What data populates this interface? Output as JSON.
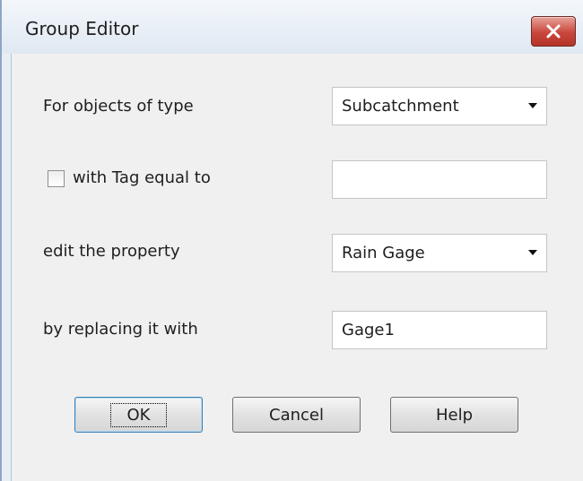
{
  "window": {
    "title": "Group Editor"
  },
  "form": {
    "object_type_label": "For objects of type",
    "object_type_value": "Subcatchment",
    "tag_label": "with Tag equal to",
    "tag_checked": false,
    "tag_value": "",
    "property_label": "edit the property",
    "property_value": "Rain Gage",
    "replace_label": "by replacing it with",
    "replace_value": "Gage1"
  },
  "buttons": {
    "ok": "OK",
    "cancel": "Cancel",
    "help": "Help"
  },
  "icons": {
    "close": "close-icon",
    "dropdown": "chevron-down-icon"
  },
  "colors": {
    "close_button": "#c9463c",
    "title_bar": "#dfe8f2",
    "client": "#f0f0f0"
  }
}
